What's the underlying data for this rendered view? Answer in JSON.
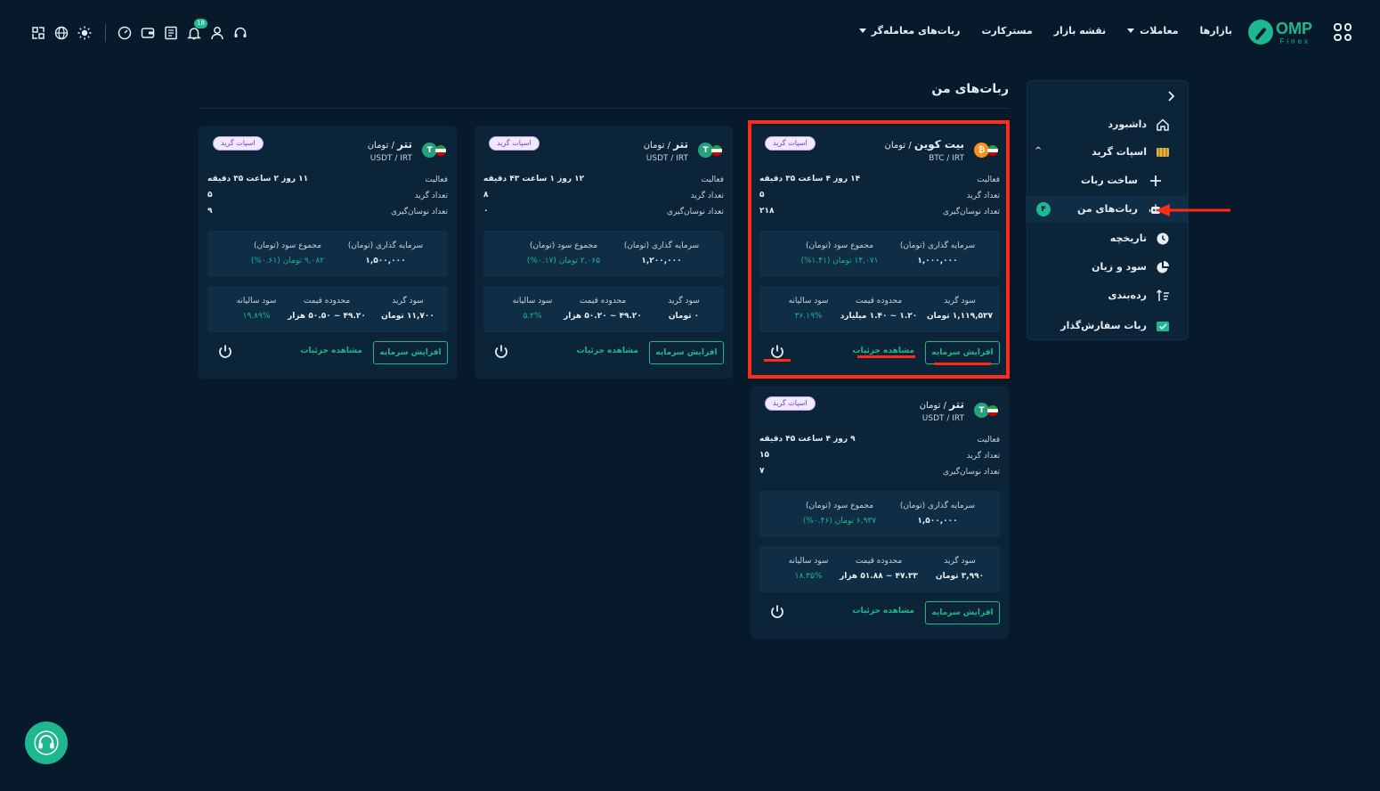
{
  "brand": {
    "name": "OMP",
    "sub": "Finex"
  },
  "nav": {
    "markets": "بازارها",
    "trades": "معاملات",
    "market_map": "نقشه بازار",
    "masterkart": "مسترکارت",
    "trader_bots": "ربات‌های معامله‌گر"
  },
  "tools": {
    "notification_count": "18"
  },
  "page": {
    "title": "ربات‌های من"
  },
  "sidebar": {
    "dashboard": "داشبورد",
    "spot_grid": "اسپات گرید",
    "create_bot": "ساخت ربات",
    "my_bots": "ربات‌های من",
    "my_bots_count": "۴",
    "history": "تاریخچه",
    "profit_loss": "سود و زیان",
    "ranking": "رده‌بندی",
    "order_bot": "ربات سفارش‌گذار"
  },
  "labels": {
    "activity": "فعالیت",
    "grid_count": "تعداد گرید",
    "swing_count": "تعداد نوسان‌گیری",
    "investment": "سرمایه گذاری (تومان)",
    "total_profit": "مجموع سود (تومان)",
    "grid_profit": "سود گرید",
    "price_range": "محدوده قیمت",
    "annual_profit": "سود سالیانه",
    "increase_capital": "افزایش سرمایه",
    "view_details": "مشاهده جزئیات",
    "tag": "اسپات گرید"
  },
  "colors": {
    "accent": "#1fb78f",
    "highlight": "#ff2a1a",
    "bg": "#061a2b",
    "card": "#0b2438"
  },
  "cards": [
    {
      "coin": "بیت کوین",
      "quote": "تومان",
      "code": "BTC / IRT",
      "icon": "bitcoin-icon",
      "activity": "۱۴ روز ۴ ساعت ۳۵ دقیقه",
      "grids": "۵",
      "swings": "۲۱۸",
      "investment": "۱,۰۰۰,۰۰۰",
      "total_profit": "۱۴,۰۷۱ تومان (۱.۴۱%)",
      "grid_profit": "۱,۱۱۹,۵۳۷ تومان",
      "price_range": "۱.۲۰ ~ ۱.۴۰ میلیارد",
      "annual_profit": "۳۶.۱۹%"
    },
    {
      "coin": "تتر",
      "quote": "تومان",
      "code": "USDT / IRT",
      "icon": "tether-icon",
      "activity": "۱۲ روز ۱ ساعت ۴۳ دقیقه",
      "grids": "۸",
      "swings": "۰",
      "investment": "۱,۲۰۰,۰۰۰",
      "total_profit": "۲,۰۶۵ تومان (۰.۱۷%)",
      "grid_profit": "۰ تومان",
      "price_range": "۴۹.۲۰ ~ ۵۰.۲۰ هزار",
      "annual_profit": "۵.۲%"
    },
    {
      "coin": "تتر",
      "quote": "تومان",
      "code": "USDT / IRT",
      "icon": "tether-icon",
      "activity": "۱۱ روز ۲ ساعت ۳۵ دقیقه",
      "grids": "۵",
      "swings": "۹",
      "investment": "۱,۵۰۰,۰۰۰",
      "total_profit": "۹,۰۸۲ تومان (۰.۶۱%)",
      "grid_profit": "۱۱,۷۰۰ تومان",
      "price_range": "۴۹.۲۰ ~ ۵۰.۵۰ هزار",
      "annual_profit": "۱۹.۸۹%"
    },
    {
      "coin": "تتر",
      "quote": "تومان",
      "code": "USDT / IRT",
      "icon": "tether-icon",
      "activity": "۹ روز ۴ ساعت ۴۵ دقیقه",
      "grids": "۱۵",
      "swings": "۷",
      "investment": "۱,۵۰۰,۰۰۰",
      "total_profit": "۶,۹۳۷ تومان (۰.۴۶%)",
      "grid_profit": "۳,۹۹۰ تومان",
      "price_range": "۴۷.۳۳ ~ ۵۱.۸۸ هزار",
      "annual_profit": "۱۸.۳۵%"
    }
  ]
}
